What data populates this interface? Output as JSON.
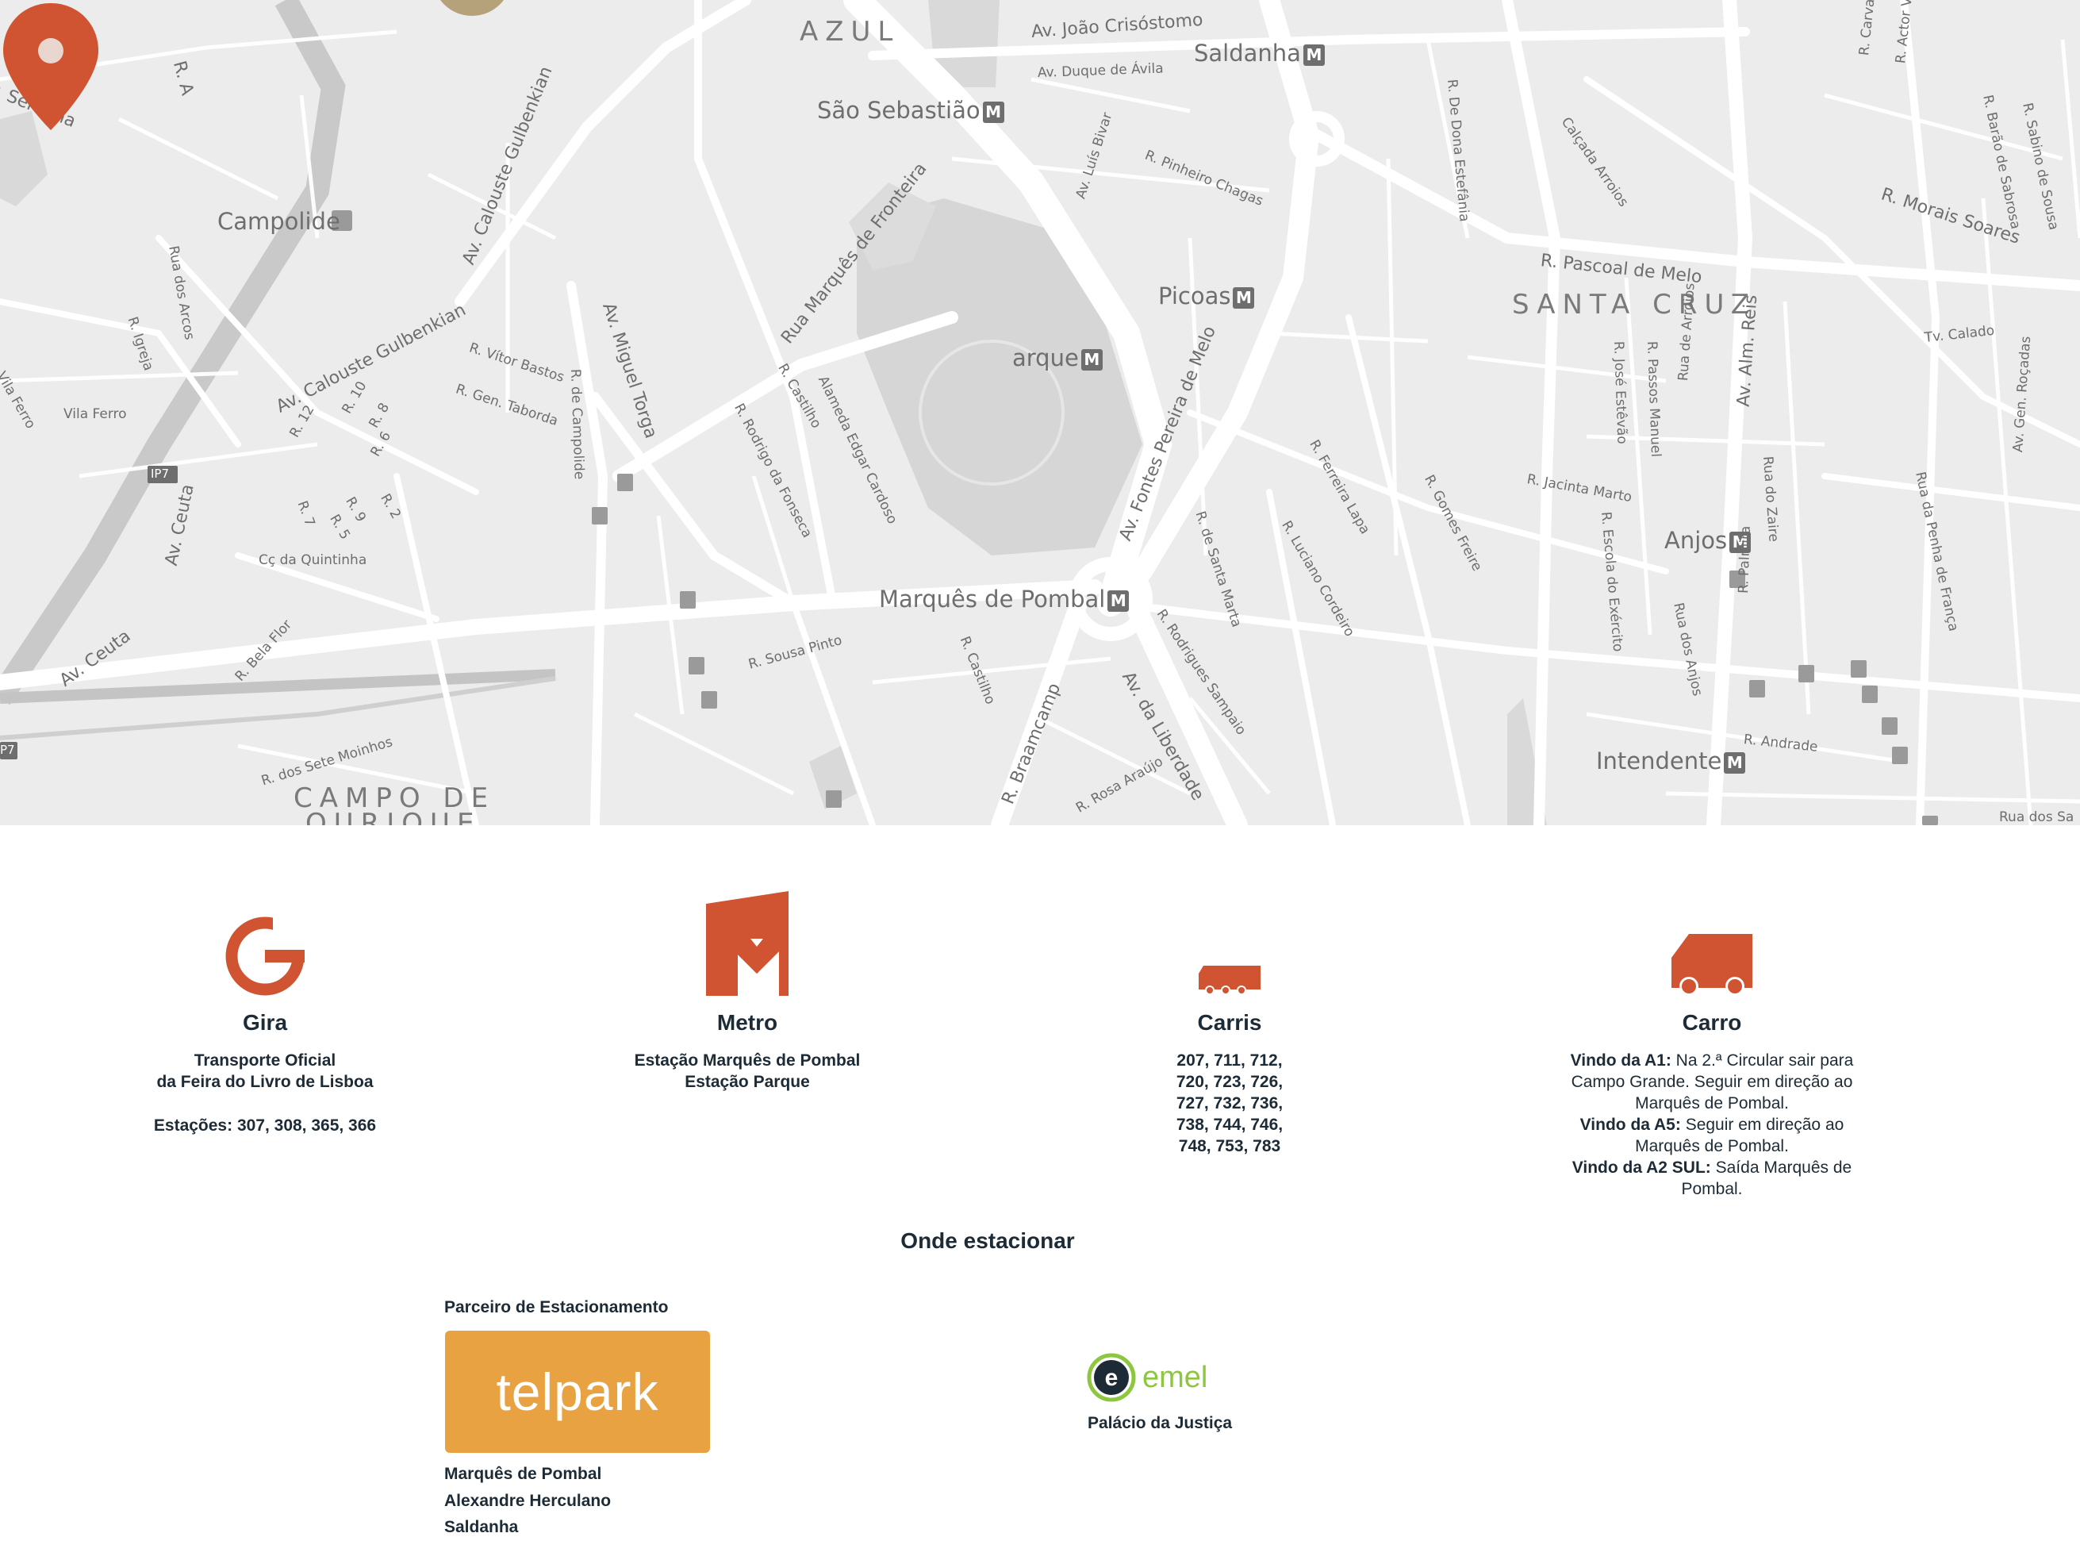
{
  "map": {
    "labels": {
      "azul": "AZUL",
      "joao_crisostomo": "Av. João Crisóstomo",
      "saldanha": "Saldanha",
      "duque_avila": "Av. Duque de Ávila",
      "sao_sebastiao": "São Sebastião",
      "campolide": "Campolide",
      "serafina": "r. Serafina",
      "ra": "R. A",
      "calouste1": "Av. Calouste Gulbenkian",
      "calouste2": "Av. Calouste Gulbenkian",
      "marques_fronteira": "Rua Marquês de Fronteira",
      "miguel_torga": "Av. Miguel Torga",
      "luis_bivar": "Av. Luís Bivar",
      "pinheiro_chagas": "R. Pinheiro Chagas",
      "dona_estefania": "R. De Dona Estefânia",
      "calcada_arroios": "Calçada Arroios",
      "morais_soares": "R. Morais Soares",
      "pascoal_melo": "R. Pascoal de Melo",
      "santa_cruz": "SANTA CRUZ",
      "picoas": "Picoas",
      "parque": "arque",
      "fontes_pereira": "Av. Fontes Pereira de Melo",
      "alm_reis": "Av. Alm. Reis",
      "jose_estevao": "R. José Estêvão",
      "passos_manuel": "R. Passos Manuel",
      "rua_arroios": "Rua de Arroios",
      "tv_calado": "Tv. Calado",
      "gen_rocadas": "Av. Gen. Roçadas",
      "vitor_bastos": "R. Vítor Bastos",
      "gen_taborda": "R. Gen. Taborda",
      "campolide_r": "R. de Campolide",
      "castilho": "R. Castilho",
      "edgar_cardoso": "Alameda Edgar Cardoso",
      "rodrigo_fonseca": "R. Rodrigo da Fonseca",
      "ferreira_lapa": "R. Ferreira Lapa",
      "gomes_freire": "R. Gomes Freire",
      "jacinta_marto": "R. Jacinta Marto",
      "luciano_cordeiro": "R. Luciano Cordeiro",
      "santa_marta": "R. de Santa Marta",
      "escola_exercito": "R. Escola do Exército",
      "rua_zaire": "Rua do Zaire",
      "penha_franca": "Rua da Penha de França",
      "anjos": "Anjos",
      "rua_anjos": "Rua dos Anjos",
      "palmira": "R. Palmira",
      "marques_pombal": "Marquês de Pombal",
      "castilho2": "R. Castilho",
      "sousa_pinto": "R. Sousa Pinto",
      "rodrigues_sampaio": "R. Rodrigues Sampaio",
      "liberdade": "Av. da Liberdade",
      "braamcamp": "R. Braamcamp",
      "rosa_araujo": "R. Rosa Araújo",
      "andrade": "R. Andrade",
      "intendente": "Intendente",
      "campo_ourique1": "CAMPO DE",
      "campo_ourique2": "OURIQUE",
      "sete_moinhos": "R. dos Sete Moinhos",
      "bela_flor": "R. Bela Flor",
      "av_ceuta1": "Av. Ceuta",
      "av_ceuta2": "Av. Ceuta",
      "quintinha": "Cç da Quintinha",
      "rua_arcos": "Rua dos Arcos",
      "r_igreja": "R. Igreja",
      "vila_ferro": "Vila Ferro",
      "vila_ferro2": "Vila Ferro",
      "ip7": "IP7",
      "ip7b": "P7",
      "r12": "R. 12",
      "r10": "R. 10",
      "r8": "R. 8",
      "r6": "R. 6",
      "r2": "R. 2",
      "r9": "R. 9",
      "r7": "R. 7",
      "r5": "R. 5",
      "carvalho_araujo": "R. Carvalho Araújo",
      "actor_vale": "R. Actor Vale",
      "barao_sabrosa": "R. Barão de Sabrosa",
      "sabino_sousa": "R. Sabino de Sousa",
      "rua_das": "Rua dos Sa",
      "metro_glyph": "M"
    }
  },
  "transport": [
    {
      "title": "Gira",
      "icon": "gira-icon",
      "lines": [
        "Transporte Oficial",
        "da Feira do Livro de Lisboa"
      ],
      "extra": "Estações: 307, 308, 365, 366"
    },
    {
      "title": "Metro",
      "icon": "metro-icon",
      "lines": [
        "Estação Marquês de Pombal",
        "Estação Parque"
      ]
    },
    {
      "title": "Carris",
      "icon": "bus-icon",
      "lines": [
        "207, 711, 712,",
        "720, 723, 726,",
        "727, 732, 736,",
        "738, 744, 746,",
        "748, 753, 783"
      ]
    },
    {
      "title": "Carro",
      "icon": "car-icon",
      "a1_label": "Vindo da A1:",
      "a1_text_1": " Na 2.ª Circular sair para",
      "a1_text_2": "Campo Grande. Seguir em direção ao",
      "a1_text_3": "Marquês de Pombal.",
      "a5_label": "Vindo da A5:",
      "a5_text_1": " Seguir em direção ao",
      "a5_text_2": "Marquês de Pombal.",
      "a2_label": "Vindo da A2 SUL:",
      "a2_text_1": " Saída Marquês de",
      "a2_text_2": "Pombal."
    }
  ],
  "parking": {
    "title": "Onde estacionar",
    "partner_label": "Parceiro de Estacionamento",
    "telpark_logo": "telpark",
    "telpark_locations": [
      "Marquês de Pombal",
      "Alexandre Herculano",
      "Saldanha"
    ],
    "emel_logo": "emel",
    "emel_logo_letter": "e",
    "emel_location": "Palácio da Justiça"
  },
  "colors": {
    "accent": "#d05332",
    "telpark": "#e9a241",
    "emel_green": "#8dc63f",
    "text_dark": "#1d2b36"
  }
}
